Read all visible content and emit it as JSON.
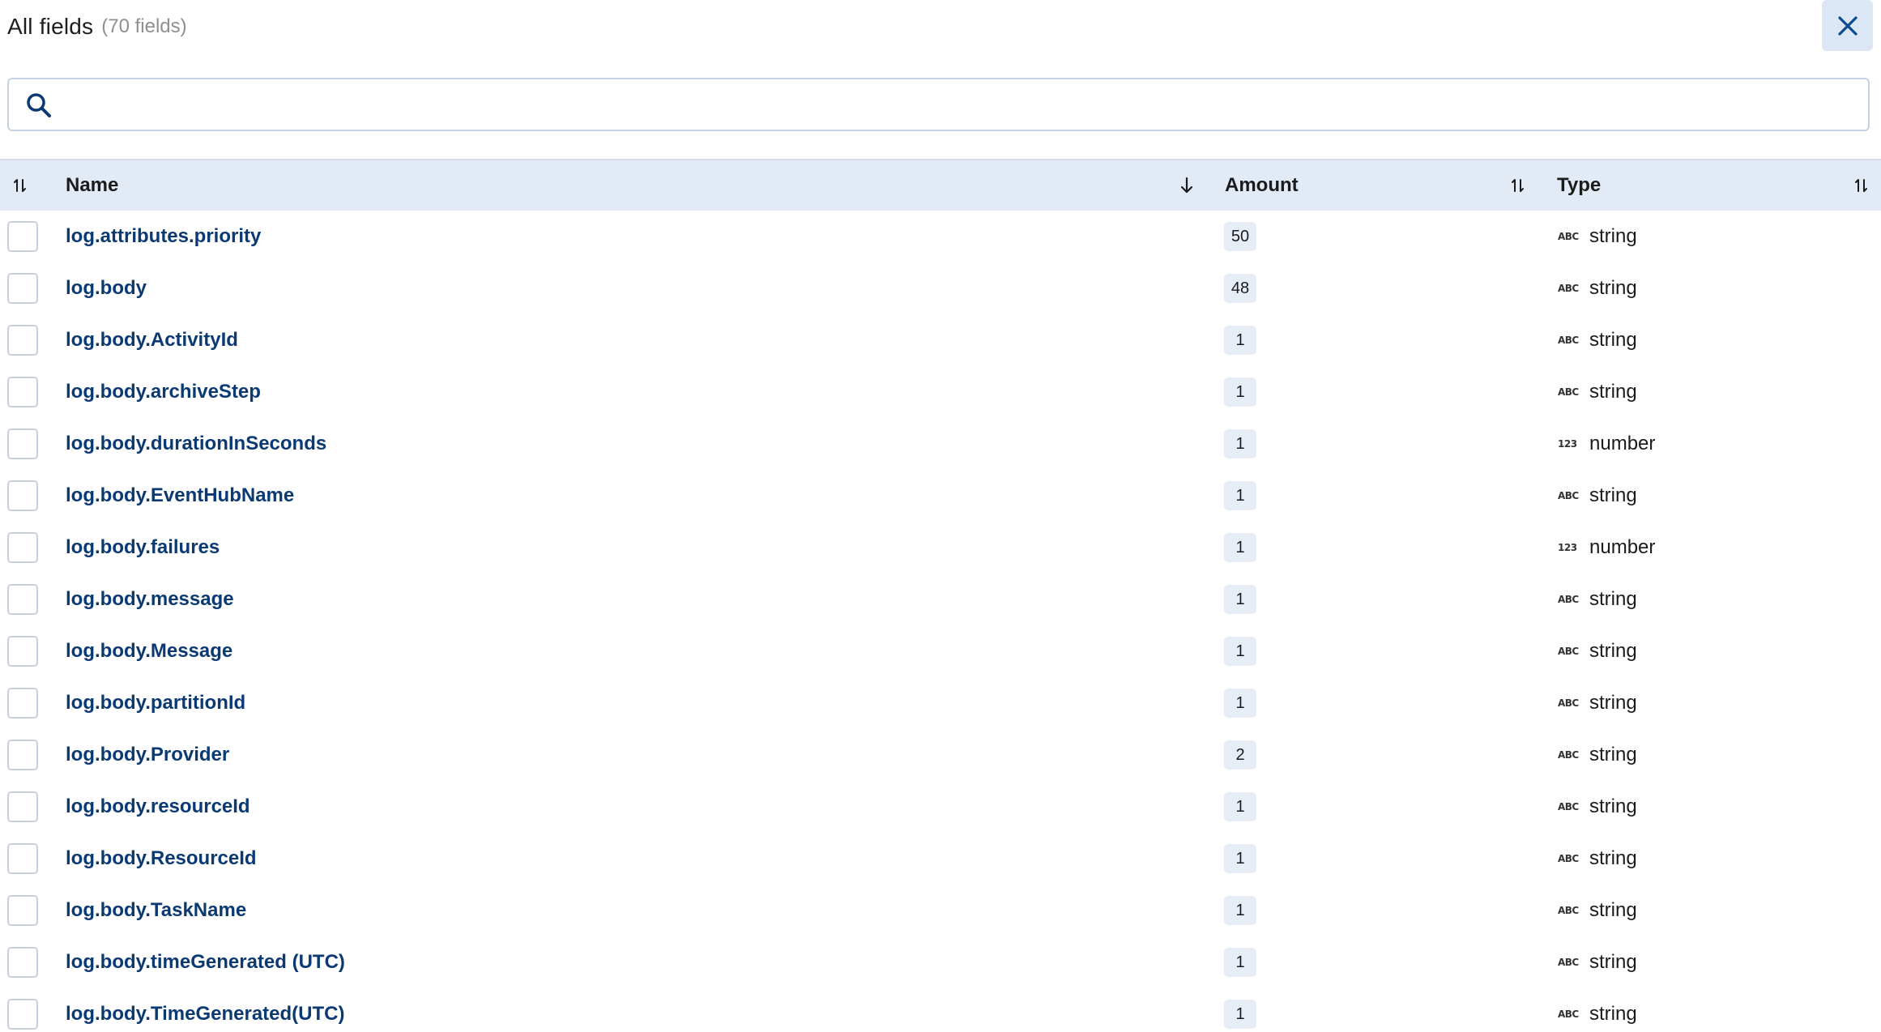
{
  "header": {
    "title": "All fields",
    "count": "(70 fields)"
  },
  "icons": {
    "close": "close-icon",
    "search": "search-icon",
    "sort_unsorted": "sort-arrows-icon",
    "sort_desc": "arrow-down-icon",
    "type_string": "ABC",
    "type_number": "123"
  },
  "colors": {
    "accent": "#0b3a73",
    "header_bg": "#e1eaf5",
    "badge_bg": "#e6edf6",
    "close_bg": "#dbe7f5"
  },
  "search": {
    "value": "",
    "placeholder": ""
  },
  "table": {
    "columns": {
      "name": "Name",
      "amount": "Amount",
      "type": "Type"
    },
    "sort": {
      "column": "Name",
      "direction": "descending"
    },
    "rows": [
      {
        "name": "log.attributes.priority",
        "amount": "50",
        "type": "string"
      },
      {
        "name": "log.body",
        "amount": "48",
        "type": "string"
      },
      {
        "name": "log.body.ActivityId",
        "amount": "1",
        "type": "string"
      },
      {
        "name": "log.body.archiveStep",
        "amount": "1",
        "type": "string"
      },
      {
        "name": "log.body.durationInSeconds",
        "amount": "1",
        "type": "number"
      },
      {
        "name": "log.body.EventHubName",
        "amount": "1",
        "type": "string"
      },
      {
        "name": "log.body.failures",
        "amount": "1",
        "type": "number"
      },
      {
        "name": "log.body.message",
        "amount": "1",
        "type": "string"
      },
      {
        "name": "log.body.Message",
        "amount": "1",
        "type": "string"
      },
      {
        "name": "log.body.partitionId",
        "amount": "1",
        "type": "string"
      },
      {
        "name": "log.body.Provider",
        "amount": "2",
        "type": "string"
      },
      {
        "name": "log.body.resourceId",
        "amount": "1",
        "type": "string"
      },
      {
        "name": "log.body.ResourceId",
        "amount": "1",
        "type": "string"
      },
      {
        "name": "log.body.TaskName",
        "amount": "1",
        "type": "string"
      },
      {
        "name": "log.body.timeGenerated (UTC)",
        "amount": "1",
        "type": "string"
      },
      {
        "name": "log.body.TimeGenerated(UTC)",
        "amount": "1",
        "type": "string"
      }
    ]
  }
}
